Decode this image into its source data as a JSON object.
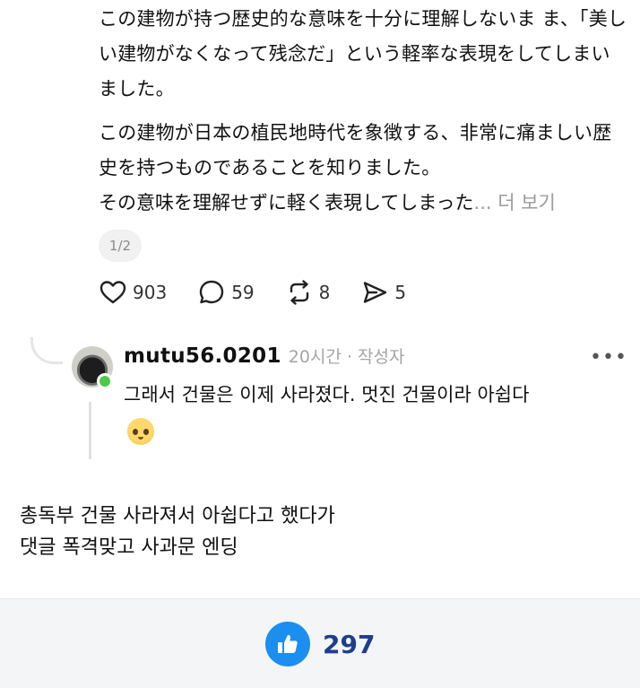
{
  "post": {
    "paragraph1": "この建物が持つ歴史的な意味を十分に理解しないま ま、「美しい建物がなくなって残念だ」という軽率な表現をしてしまいました。",
    "paragraph2": "この建物が日本の植民地時代を象徴する、非常に痛ましい歴史を持つものであることを知りました。",
    "paragraph3": "その意味を理解せずに軽く表現してしまった",
    "ellipsis": "...",
    "more_label": " 더 보기",
    "page_indicator": "1/2"
  },
  "actions": {
    "likes": "903",
    "comments": "59",
    "reposts": "8",
    "shares": "5"
  },
  "reply": {
    "username": "mutu56.0201",
    "meta": "20시간 · 작성자",
    "more_label": "•••",
    "text": "그래서 건물은 이제 사라졌다. 멋진 건물이라 아쉽다"
  },
  "caption": {
    "line1": "총독부 건물 사라져서 아쉽다고 했다가",
    "line2": "댓글 폭격맞고 사과문 엔딩"
  },
  "footer": {
    "like_count": "297"
  },
  "colors": {
    "accent": "#1b8ef0",
    "count": "#1f3d8c",
    "muted": "#a5a5a5",
    "online": "#4ec94a"
  },
  "icons": [
    "heart-icon",
    "comment-icon",
    "repost-icon",
    "share-icon",
    "more-icon",
    "thumbs-up-icon",
    "pleading-face-emoji"
  ]
}
